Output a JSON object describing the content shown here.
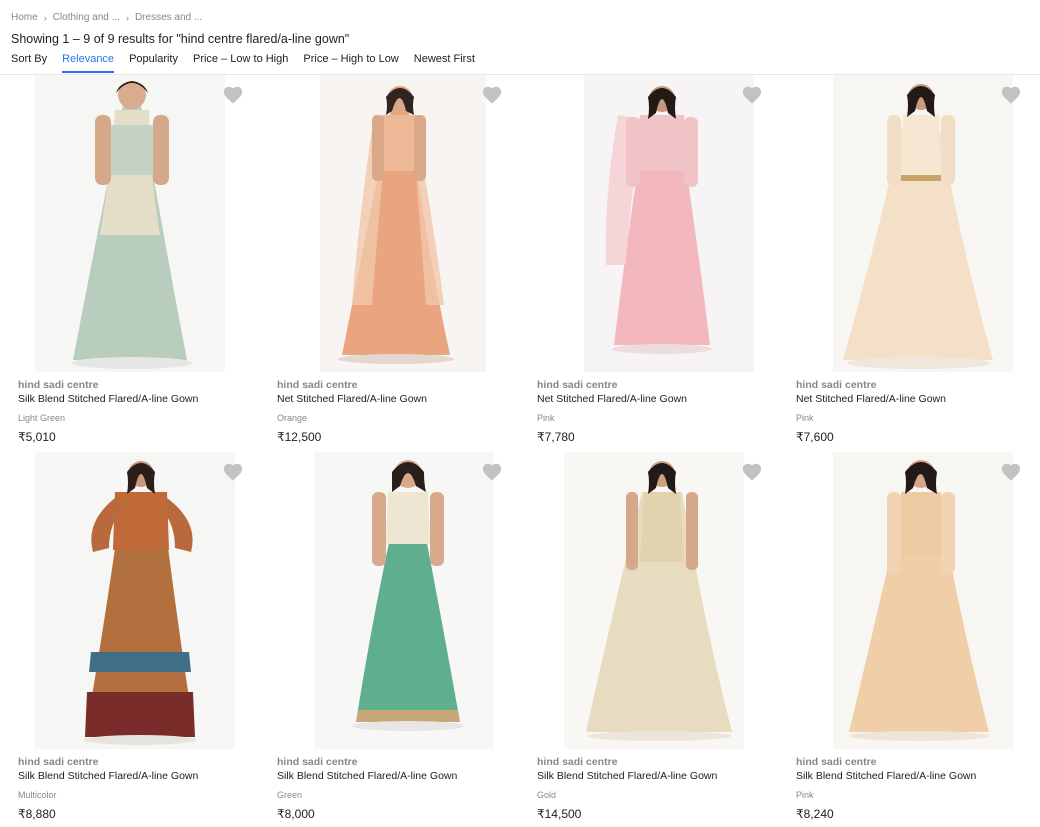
{
  "breadcrumb": [
    {
      "label": "Home"
    },
    {
      "label": "Clothing and ..."
    },
    {
      "label": "Dresses and ..."
    }
  ],
  "results_title": "Showing 1 – 9 of 9 results for \"hind centre flared/a-line gown\"",
  "sort": {
    "label": "Sort By",
    "options": [
      "Relevance",
      "Popularity",
      "Price – Low to High",
      "Price – High to Low",
      "Newest First"
    ],
    "active": "Relevance"
  },
  "colors": {
    "accent": "#2874f0",
    "wishlist": "#c2c2c2",
    "muted_text": "#878787"
  },
  "products": [
    {
      "brand": "hind sadi centre",
      "title": "Silk Blend Stitched Flared/A-line Gown",
      "color": "Light Green",
      "price": "₹5,010",
      "icon": "heart-icon"
    },
    {
      "brand": "hind sadi centre",
      "title": "Net Stitched Flared/A-line Gown",
      "color": "Orange",
      "price": "₹12,500",
      "icon": "heart-icon"
    },
    {
      "brand": "hind sadi centre",
      "title": "Net Stitched Flared/A-line Gown",
      "color": "Pink",
      "price": "₹7,780",
      "icon": "heart-icon"
    },
    {
      "brand": "hind sadi centre",
      "title": "Net Stitched Flared/A-line Gown",
      "color": "Pink",
      "price": "₹7,600",
      "icon": "heart-icon"
    },
    {
      "brand": "hind sadi centre",
      "title": "Silk Blend Stitched Flared/A-line Gown",
      "color": "Multicolor",
      "price": "₹8,880",
      "icon": "heart-icon"
    },
    {
      "brand": "hind sadi centre",
      "title": "Silk Blend Stitched Flared/A-line Gown",
      "color": "Green",
      "price": "₹8,000",
      "icon": "heart-icon"
    },
    {
      "brand": "hind sadi centre",
      "title": "Silk Blend Stitched Flared/A-line Gown",
      "color": "Gold",
      "price": "₹14,500",
      "icon": "heart-icon"
    },
    {
      "brand": "hind sadi centre",
      "title": "Silk Blend Stitched Flared/A-line Gown",
      "color": "Pink",
      "price": "₹8,240",
      "icon": "heart-icon"
    }
  ]
}
